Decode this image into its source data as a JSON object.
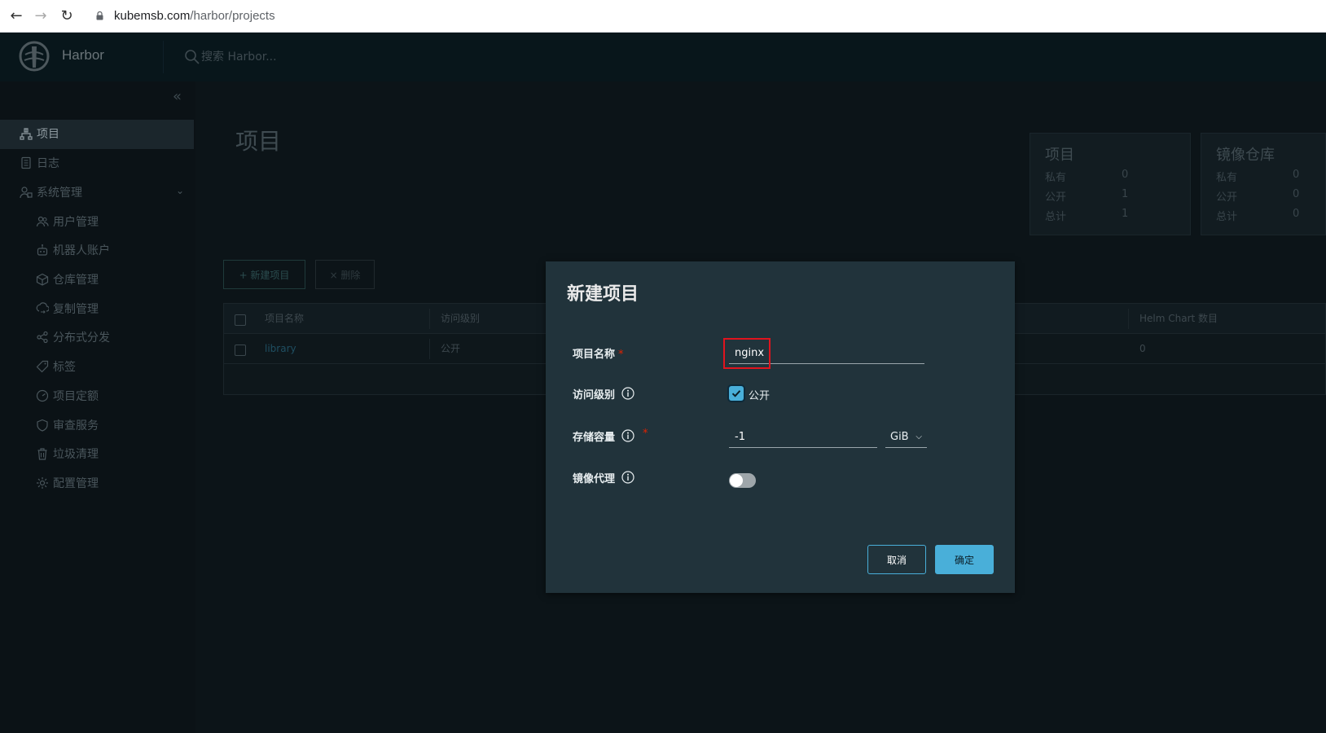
{
  "browser": {
    "url_host": "kubemsb.com",
    "url_path": "/harbor/projects"
  },
  "header": {
    "app_name": "Harbor",
    "search_placeholder": "搜索 Harbor..."
  },
  "sidebar": {
    "items": [
      {
        "label": "项目",
        "icon": "projects-icon",
        "active": true
      },
      {
        "label": "日志",
        "icon": "logs-icon"
      },
      {
        "label": "系统管理",
        "icon": "admin-icon",
        "expandable": true
      },
      {
        "label": "用户管理",
        "icon": "users-icon"
      },
      {
        "label": "机器人账户",
        "icon": "robot-icon"
      },
      {
        "label": "仓库管理",
        "icon": "registry-icon"
      },
      {
        "label": "复制管理",
        "icon": "replication-icon"
      },
      {
        "label": "分布式分发",
        "icon": "distribution-icon"
      },
      {
        "label": "标签",
        "icon": "tag-icon"
      },
      {
        "label": "项目定额",
        "icon": "quota-icon"
      },
      {
        "label": "审查服务",
        "icon": "shield-icon"
      },
      {
        "label": "垃圾清理",
        "icon": "trash-icon"
      },
      {
        "label": "配置管理",
        "icon": "gear-icon"
      }
    ]
  },
  "main": {
    "title": "项目",
    "stats": [
      {
        "title": "项目",
        "rows": [
          {
            "label": "私有",
            "value": "0"
          },
          {
            "label": "公开",
            "value": "1"
          },
          {
            "label": "总计",
            "value": "1"
          }
        ]
      },
      {
        "title": "镜像仓库",
        "rows": [
          {
            "label": "私有",
            "value": "0"
          },
          {
            "label": "公开",
            "value": "0"
          },
          {
            "label": "总计",
            "value": "0"
          }
        ]
      }
    ],
    "new_project_label": "+ 新建项目",
    "delete_label": "× 删除",
    "table": {
      "headers": [
        "项目名称",
        "访问级别",
        "Helm Chart 数目"
      ],
      "rows": [
        {
          "name": "library",
          "access": "公开",
          "helm_count": "0"
        }
      ]
    }
  },
  "modal": {
    "title": "新建项目",
    "name_label": "项目名称",
    "required_mark": "*",
    "name_value": "nginx",
    "access_label": "访问级别",
    "public_checked": true,
    "public_label": "公开",
    "storage_label": "存储容量",
    "storage_value": "-1",
    "storage_unit": "GiB",
    "proxy_label": "镜像代理",
    "proxy_enabled": false,
    "cancel_label": "取消",
    "ok_label": "确定"
  },
  "colors": {
    "accent": "#49afd9",
    "highlight": "#e0141e",
    "required": "#e12200"
  }
}
